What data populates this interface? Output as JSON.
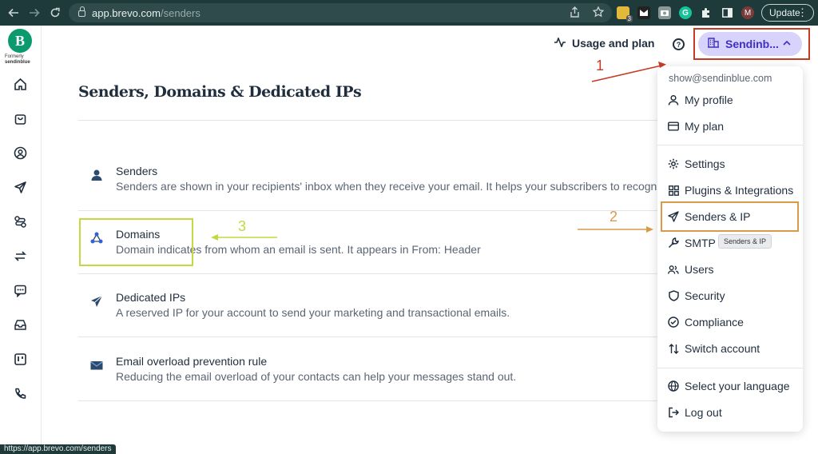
{
  "browser": {
    "url_host": "app.brevo.com",
    "url_path": "/senders",
    "update_label": "Update",
    "profile_initial": "M",
    "ext_badge": "3",
    "status_url": "https://app.brevo.com/senders"
  },
  "sidebar": {
    "logo_letter": "B",
    "formerly": "Formerly",
    "formerly_brand": "sendinblue",
    "icons": [
      "home-icon",
      "bag-icon",
      "contact-icon",
      "send-icon",
      "automation-icon",
      "transactional-icon",
      "conversations-icon",
      "inbox-icon",
      "board-icon",
      "phone-icon"
    ]
  },
  "header": {
    "usage_label": "Usage and plan",
    "account_label": "Sendinb..."
  },
  "page": {
    "title": "Senders, Domains & Dedicated IPs",
    "rows": [
      {
        "title": "Senders",
        "desc": "Senders are shown in your recipients' inbox when they receive your email. It helps your subscribers to recogn"
      },
      {
        "title": "Domains",
        "desc": "Domain indicates from whom an email is sent. It appears in From: Header"
      },
      {
        "title": "Dedicated IPs",
        "desc": "A reserved IP for your account to send your marketing and transactional emails."
      },
      {
        "title": "Email overload prevention rule",
        "desc": "Reducing the email overload of your contacts can help your messages stand out."
      }
    ]
  },
  "menu": {
    "email": "show@sendinblue.com",
    "items": [
      {
        "label": "My profile",
        "icon": "user-icon"
      },
      {
        "label": "My plan",
        "icon": "card-icon"
      },
      {
        "label": "Settings",
        "icon": "gear-icon"
      },
      {
        "label": "Plugins & Integrations",
        "icon": "grid-icon"
      },
      {
        "label": "Senders & IP",
        "icon": "send-icon"
      },
      {
        "label": "SMTP &",
        "icon": "wrench-icon"
      },
      {
        "label": "Users",
        "icon": "users-icon"
      },
      {
        "label": "Security",
        "icon": "shield-icon"
      },
      {
        "label": "Compliance",
        "icon": "check-circle-icon"
      },
      {
        "label": "Switch account",
        "icon": "switch-icon"
      },
      {
        "label": "Select your language",
        "icon": "globe-icon"
      },
      {
        "label": "Log out",
        "icon": "logout-icon"
      }
    ],
    "tooltip": "Senders & IP"
  },
  "annotations": {
    "one": "1",
    "two": "2",
    "three": "3",
    "colors": {
      "one": "#c63a24",
      "two": "#d99a4a",
      "three": "#c6d841"
    }
  }
}
